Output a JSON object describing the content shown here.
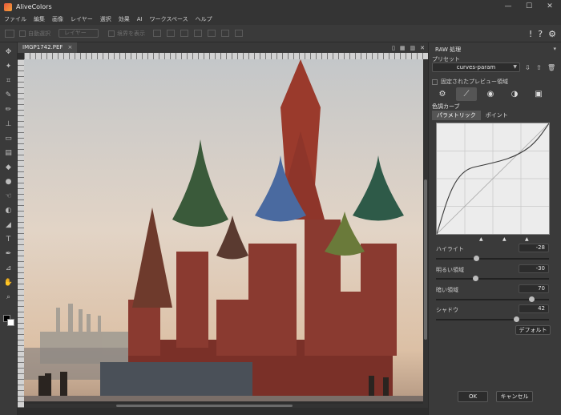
{
  "app": {
    "title": "AliveColors"
  },
  "window_controls": {
    "minimize": "—",
    "maximize": "☐",
    "close": "✕"
  },
  "menu": [
    "ファイル",
    "編集",
    "画像",
    "レイヤー",
    "選択",
    "効果",
    "AI",
    "ワークスペース",
    "ヘルプ"
  ],
  "toolbar": {
    "auto_select": "自動選択",
    "layer_select": "レイヤー",
    "show_handles": "境界を表示"
  },
  "header_icons": {
    "alert": "!",
    "help": "?",
    "settings": "⚙"
  },
  "document": {
    "tab_name": "IMGP1742.PEF",
    "tab_close": "×"
  },
  "panel": {
    "title": "RAW 処理",
    "preset_label": "プリセット",
    "preset_value": "curves-param",
    "pin_preview_label": "固定されたプレビュー領域",
    "curves_heading": "色調カーブ",
    "subtab_parametric": "パラメトリック",
    "subtab_point": "ポイント",
    "sliders": [
      {
        "label": "ハイライト",
        "value": "-28",
        "fraction": 0.36
      },
      {
        "label": "明るい領域",
        "value": "-30",
        "fraction": 0.35
      },
      {
        "label": "暗い領域",
        "value": "70",
        "fraction": 0.85
      },
      {
        "label": "シャドウ",
        "value": "42",
        "fraction": 0.71
      }
    ],
    "default_button": "デフォルト",
    "ok_button": "OK",
    "cancel_button": "キャンセル"
  },
  "colors": {
    "accent": "#4a90d9",
    "panel_bg": "#3a3a3a",
    "input_bg": "#2c2c2c"
  }
}
